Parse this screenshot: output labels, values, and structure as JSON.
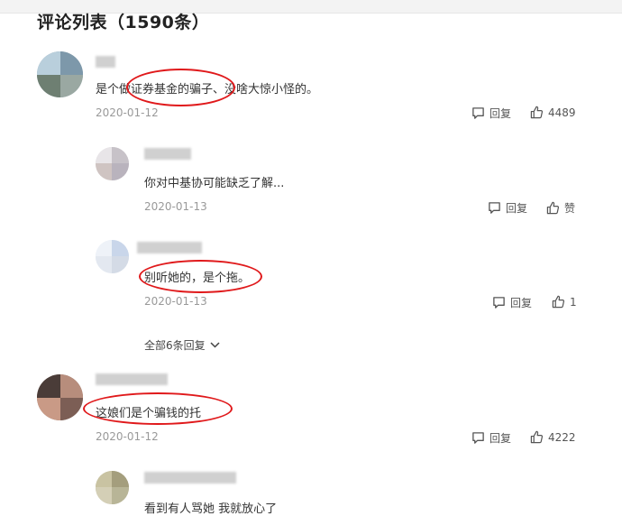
{
  "header": {
    "title": "评论列表（1590条）"
  },
  "comments": [
    {
      "text": "是个做证券基金的骗子、没啥大惊小怪的。",
      "date": "2020-01-12",
      "reply_label": "回复",
      "like_count": "4489",
      "replies": [
        {
          "text": "你对中基协可能缺乏了解...",
          "date": "2020-01-13",
          "reply_label": "回复",
          "like_label": "赞"
        },
        {
          "text": "别听她的，是个拖。",
          "date": "2020-01-13",
          "reply_label": "回复",
          "like_count": "1"
        }
      ],
      "more_replies_label": "全部6条回复"
    },
    {
      "text": "这娘们是个骗钱的托",
      "date": "2020-01-12",
      "reply_label": "回复",
      "like_count": "4222",
      "replies": [
        {
          "text": "看到有人骂她 我就放心了"
        }
      ]
    }
  ],
  "colors": {
    "annotation_ring": "#e0191b",
    "muted_text": "#999999",
    "body_text": "#333333"
  },
  "icons": {
    "reply": "comment-bubble-icon",
    "like": "thumbs-up-icon",
    "expand": "chevron-down-icon"
  }
}
